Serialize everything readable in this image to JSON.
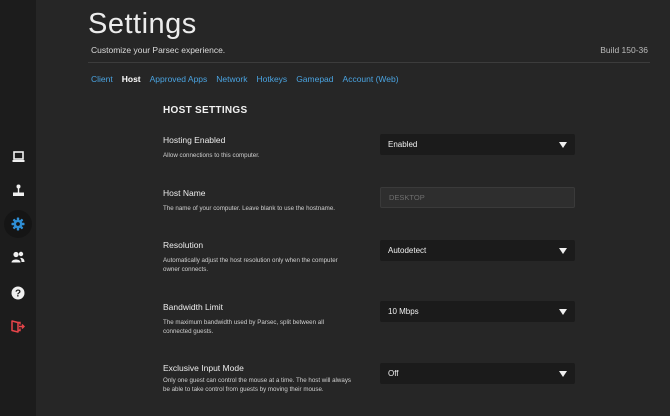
{
  "header": {
    "title": "Settings",
    "subtitle": "Customize your Parsec experience.",
    "build": "Build 150-36"
  },
  "sidebar": {
    "items": [
      {
        "name": "computers-icon"
      },
      {
        "name": "arcade-icon"
      },
      {
        "name": "gear-icon",
        "active": true
      },
      {
        "name": "friends-icon"
      },
      {
        "name": "help-icon"
      },
      {
        "name": "logout-icon"
      }
    ]
  },
  "tabs": [
    {
      "label": "Client"
    },
    {
      "label": "Host",
      "active": true
    },
    {
      "label": "Approved Apps"
    },
    {
      "label": "Network"
    },
    {
      "label": "Hotkeys"
    },
    {
      "label": "Gamepad"
    },
    {
      "label": "Account (Web)"
    }
  ],
  "section": {
    "title": "HOST SETTINGS"
  },
  "settings": [
    {
      "label": "Hosting Enabled",
      "desc": "Allow connections to this computer.",
      "value": "Enabled"
    },
    {
      "label": "Host Name",
      "desc": "The name of your computer. Leave blank to use the hostname.",
      "placeholder": "DESKTOP"
    },
    {
      "label": "Resolution",
      "desc": "Automatically adjust the host resolution only when the computer owner connects.",
      "value": "Autodetect"
    },
    {
      "label": "Bandwidth Limit",
      "desc": "The maximum bandwidth used by Parsec, split between all connected guests.",
      "value": "10 Mbps"
    },
    {
      "label": "Exclusive Input Mode",
      "desc": "Only one guest can control the mouse at a time. The host will always be able to take control from guests by moving their mouse.",
      "value": "Off"
    }
  ],
  "colors": {
    "accent": "#4aa3e0",
    "logout": "#e8454a",
    "background": "#262626",
    "sidebar": "#1c1c1c"
  }
}
